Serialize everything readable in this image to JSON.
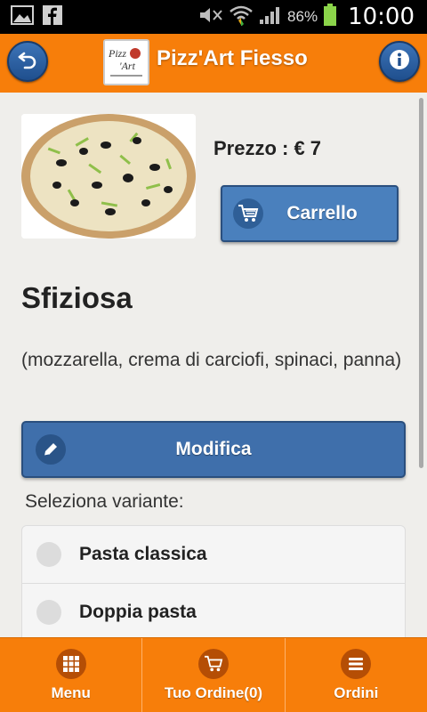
{
  "status_bar": {
    "battery_percent": "86%",
    "time": "10:00"
  },
  "header": {
    "title": "Pizz'Art Fiesso",
    "logo_text": "Pizz Art"
  },
  "product": {
    "price": "Prezzo : € 7",
    "cart_button": "Carrello",
    "name": "Sfiziosa",
    "ingredients": "(mozzarella, crema di carciofi, spinaci, panna)",
    "modify_button": "Modifica",
    "variant_label": "Seleziona variante:",
    "variants": [
      "Pasta classica",
      "Doppia pasta"
    ]
  },
  "bottom_nav": {
    "items": [
      "Menu",
      "Tuo Ordine(0)",
      "Ordini"
    ]
  },
  "colors": {
    "accent": "#f77e0a",
    "button_blue": "#3f6fab",
    "background": "#efeeeb"
  }
}
